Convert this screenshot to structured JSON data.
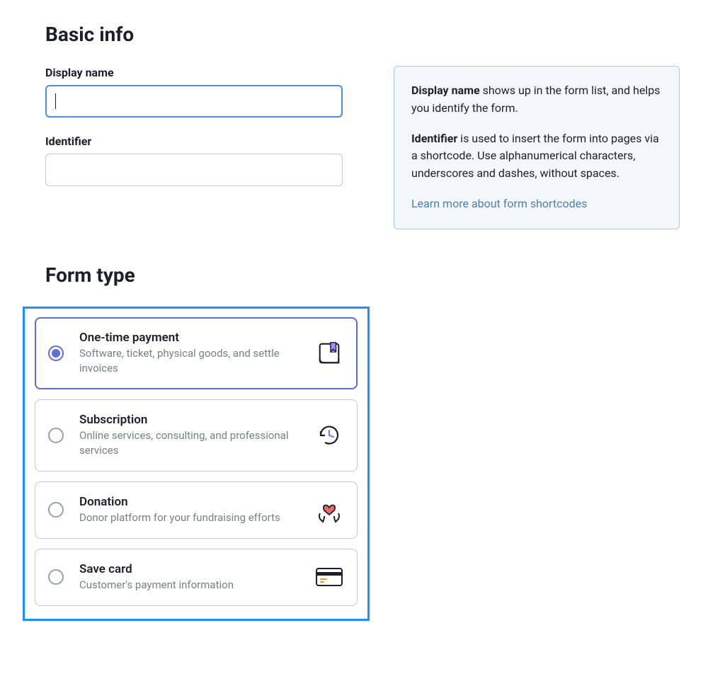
{
  "basicInfo": {
    "title": "Basic info",
    "displayNameLabel": "Display name",
    "displayNameValue": "",
    "identifierLabel": "Identifier",
    "identifierValue": ""
  },
  "info": {
    "displayNameLabel": "Display name",
    "displayNameText": " shows up in the form list, and helps you identify the form.",
    "identifierLabel": "Identifier",
    "identifierText": " is used to insert the form into pages via a shortcode. Use alphanumerical characters, underscores and dashes, without spaces.",
    "linkText": "Learn more about form shortcodes"
  },
  "formType": {
    "title": "Form type",
    "options": [
      {
        "title": "One-time payment",
        "desc": "Software, ticket, physical goods, and settle invoices",
        "selected": true
      },
      {
        "title": "Subscription",
        "desc": "Online services, consulting, and professional services",
        "selected": false
      },
      {
        "title": "Donation",
        "desc": "Donor platform for your fundraising efforts",
        "selected": false
      },
      {
        "title": "Save card",
        "desc": "Customer's payment information",
        "selected": false
      }
    ]
  }
}
